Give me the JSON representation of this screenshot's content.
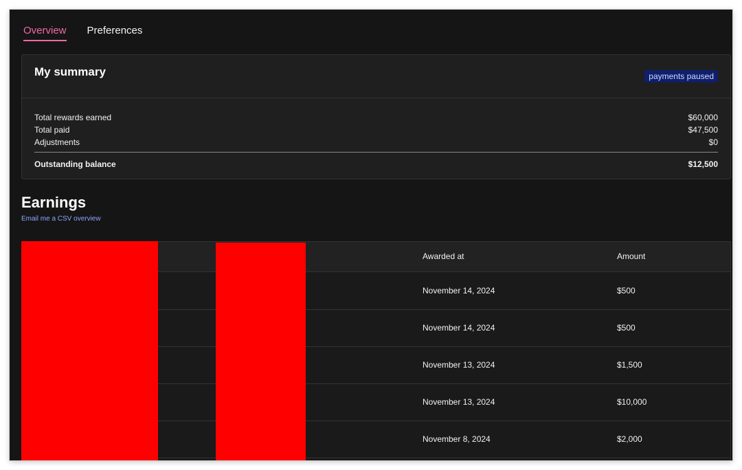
{
  "tabs": {
    "overview": "Overview",
    "preferences": "Preferences"
  },
  "summary": {
    "title": "My summary",
    "badge": "payments paused",
    "rows": [
      {
        "label": "Total rewards earned",
        "value": "$60,000"
      },
      {
        "label": "Total paid",
        "value": "$47,500"
      },
      {
        "label": "Adjustments",
        "value": "$0"
      }
    ],
    "total": {
      "label": "Outstanding balance",
      "value": "$12,500"
    }
  },
  "earnings": {
    "title": "Earnings",
    "csv_link": "Email me a CSV overview",
    "columns": {
      "awarded_at": "Awarded at",
      "amount": "Amount"
    },
    "rows": [
      {
        "awarded_at": "November 14, 2024",
        "amount": "$500"
      },
      {
        "awarded_at": "November 14, 2024",
        "amount": "$500"
      },
      {
        "awarded_at": "November 13, 2024",
        "amount": "$1,500"
      },
      {
        "awarded_at": "November 13, 2024",
        "amount": "$10,000"
      },
      {
        "awarded_at": "November 8, 2024",
        "amount": "$2,000"
      }
    ]
  },
  "colors": {
    "accent": "#f06aa6",
    "background": "#151515",
    "badge_bg": "#0f1f6b",
    "link": "#8fa6ff",
    "redaction": "#ff0000"
  }
}
